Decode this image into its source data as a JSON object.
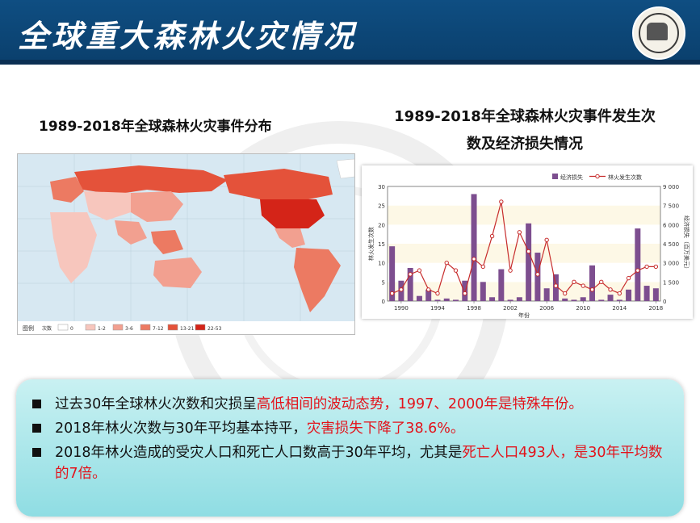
{
  "header": {
    "title": "全球重大森林火灾情况"
  },
  "left_panel": {
    "title": "1989-2018年全球森林火灾事件分布",
    "legend_label": "图例",
    "legend_sub": "次数",
    "legend_ranges": [
      "0",
      "1-2",
      "3-6",
      "7-12",
      "13-21",
      "22-53"
    ],
    "legend_colors": [
      "#ffffff",
      "#f7c6bd",
      "#f2a090",
      "#ec7a62",
      "#e4523a",
      "#d42418"
    ]
  },
  "right_panel": {
    "title_line1": "1989-2018年全球森林火灾事件发生次",
    "title_line2": "数及经济损失情况"
  },
  "chart_data": {
    "type": "bar",
    "x": [
      1989,
      1990,
      1991,
      1992,
      1993,
      1994,
      1995,
      1996,
      1997,
      1998,
      1999,
      2000,
      2001,
      2002,
      2003,
      2004,
      2005,
      2006,
      2007,
      2008,
      2009,
      2010,
      2011,
      2012,
      2013,
      2014,
      2015,
      2016,
      2017,
      2018
    ],
    "series": [
      {
        "name": "经济损失",
        "axis": "right",
        "color": "#7d4e8f",
        "values": [
          4300,
          1600,
          2600,
          400,
          900,
          100,
          200,
          100,
          1600,
          8400,
          1500,
          300,
          2500,
          100,
          300,
          6100,
          3800,
          1000,
          2100,
          200,
          100,
          300,
          2800,
          100,
          500,
          100,
          900,
          5700,
          1200,
          1000
        ]
      },
      {
        "name": "林火发生次数",
        "axis": "left",
        "color": "#c72c2c",
        "values": [
          2,
          3,
          7,
          8,
          3,
          2,
          10,
          8,
          2,
          11,
          9,
          17,
          26,
          8,
          18,
          13,
          7,
          16,
          4,
          2,
          5,
          4,
          3,
          5,
          3,
          2,
          6,
          8,
          9,
          9
        ]
      }
    ],
    "xticks": [
      "1990",
      "1994",
      "1998",
      "2002",
      "2006",
      "2010",
      "2014",
      "2018"
    ],
    "xlabel": "年份",
    "ylabel": "林火发生次数",
    "ylabel_right": "经济损失（百万美元）",
    "ylim": [
      0,
      30
    ],
    "yticks": [
      "0",
      "5",
      "10",
      "15",
      "20",
      "25",
      "30"
    ],
    "ylim_right": [
      0,
      9000
    ],
    "yticks_right": [
      "0",
      "1 500",
      "3 000",
      "4 500",
      "6 000",
      "7 500",
      "9 000"
    ]
  },
  "bullets": [
    {
      "pre": "过去30年全球林火次数和灾损呈",
      "red": "高低相间的波动态势，1997、2000年是特殊年份。",
      "post": ""
    },
    {
      "pre": "2018年林火次数与30年平均基本持平，",
      "red": "灾害损失下降了38.6%。",
      "post": ""
    },
    {
      "pre": "2018年林火造成的受灾人口和死亡人口数高于30年平均，尤其是",
      "red": "死亡人口493人，是30年平均数的7倍。",
      "post": ""
    }
  ]
}
